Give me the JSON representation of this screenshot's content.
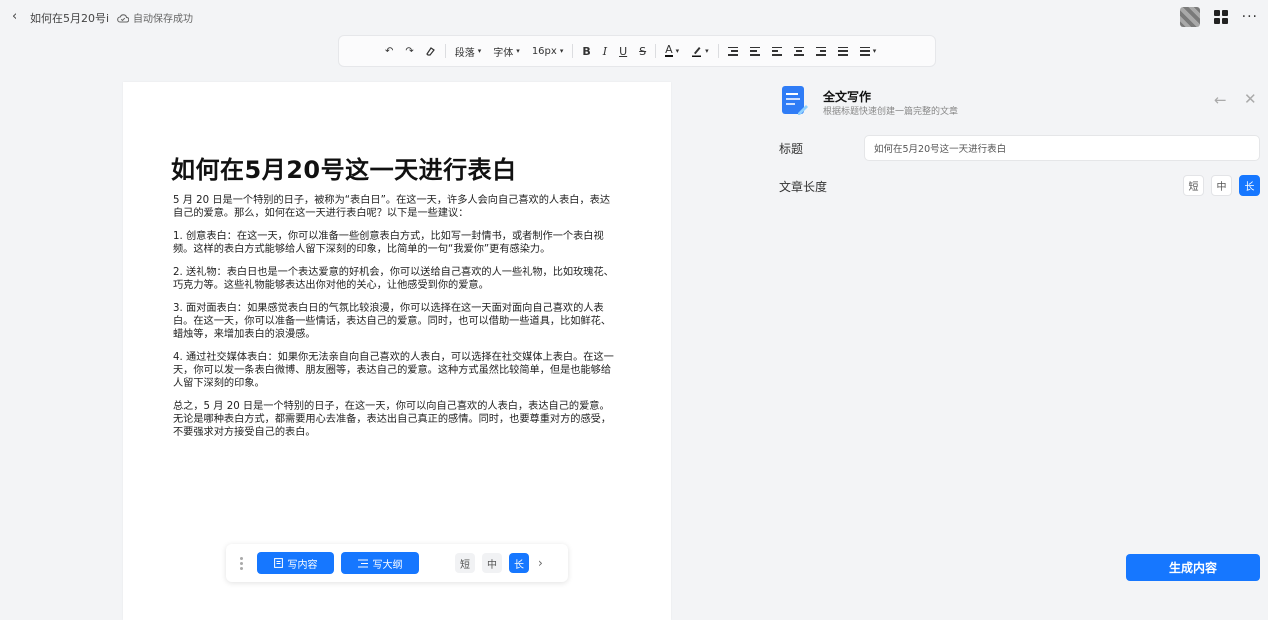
{
  "header": {
    "back_icon": "chevron-left-icon",
    "doc_title": "如何在5月20号i",
    "autosave_icon": "cloud-check-icon",
    "autosave_text": "自动保存成功",
    "apps_icon": "grid-icon",
    "more_label": "···"
  },
  "toolbar": {
    "undo": "↶",
    "redo": "↷",
    "clear_format": "⌫",
    "paragraph": "段落",
    "font": "字体",
    "size": "16px",
    "bold": "B",
    "italic": "I",
    "underline": "U",
    "strike": "S",
    "font_color": "A",
    "caret": "▾"
  },
  "document": {
    "title": "如何在5月20号这一天进行表白",
    "paragraphs": [
      "5 月 20 日是一个特别的日子，被称为“表白日”。在这一天，许多人会向自己喜欢的人表白，表达自己的爱意。那么，如何在这一天进行表白呢？以下是一些建议：",
      "1. 创意表白：在这一天，你可以准备一些创意表白方式，比如写一封情书，或者制作一个表白视频。这样的表白方式能够给人留下深刻的印象，比简单的一句“我爱你”更有感染力。",
      "2. 送礼物：表白日也是一个表达爱意的好机会，你可以送给自己喜欢的人一些礼物，比如玫瑰花、巧克力等。这些礼物能够表达出你对他的关心，让他感受到你的爱意。",
      "3. 面对面表白：如果感觉表白日的气氛比较浪漫，你可以选择在这一天面对面向自己喜欢的人表白。在这一天，你可以准备一些情话，表达自己的爱意。同时，也可以借助一些道具，比如鲜花、蜡烛等，来增加表白的浪漫感。",
      "4. 通过社交媒体表白：如果你无法亲自向自己喜欢的人表白，可以选择在社交媒体上表白。在这一天，你可以发一条表白微博、朋友圈等，表达自己的爱意。这种方式虽然比较简单，但是也能够给人留下深刻的印象。",
      "总之，5 月 20 日是一个特别的日子，在这一天，你可以向自己喜欢的人表白，表达自己的爱意。无论是哪种表白方式，都需要用心去准备，表达出自己真正的感情。同时，也要尊重对方的感受，不要强求对方接受自己的表白。"
    ]
  },
  "floatbar": {
    "write_content": "写内容",
    "write_outline": "写大纲",
    "short": "短",
    "medium": "中",
    "long": "长",
    "next": "›"
  },
  "panel": {
    "title": "全文写作",
    "subtitle": "根据标题快速创建一篇完整的文章",
    "back": "←",
    "close": "✕",
    "title_label": "标题",
    "title_value": "如何在5月20号这一天进行表白",
    "length_label": "文章长度",
    "short": "短",
    "medium": "中",
    "long": "长",
    "generate": "生成内容"
  },
  "colors": {
    "accent": "#1677ff"
  }
}
